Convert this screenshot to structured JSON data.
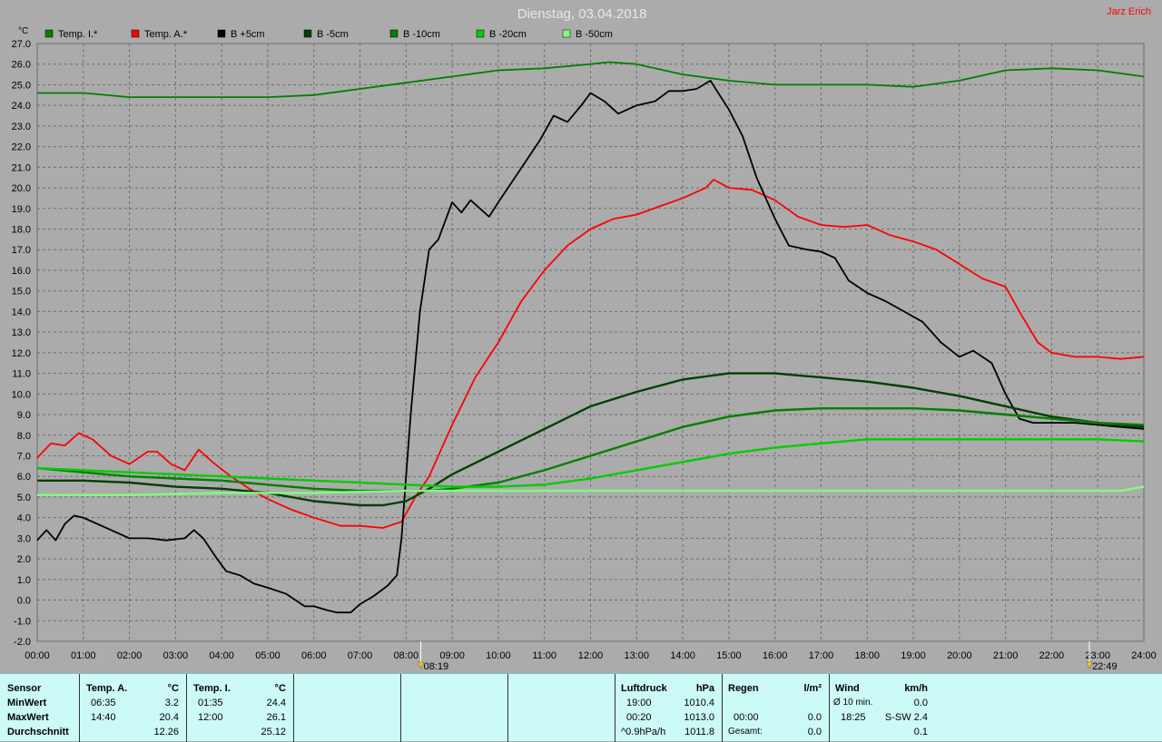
{
  "header": {
    "title": "Dienstag, 03.04.2018",
    "author": "Jarz Erich",
    "y_unit": "°C"
  },
  "chart_data": {
    "type": "line",
    "title": "Dienstag, 03.04.2018",
    "ylabel": "°C",
    "ylim": [
      -2.0,
      27.0
    ],
    "xlim": [
      0,
      24
    ],
    "grid": true,
    "legend": "top",
    "y_ticks": [
      "-2.0",
      "-1.0",
      "0.0",
      "1.0",
      "2.0",
      "3.0",
      "4.0",
      "5.0",
      "6.0",
      "7.0",
      "8.0",
      "9.0",
      "10.0",
      "11.0",
      "12.0",
      "13.0",
      "14.0",
      "15.0",
      "16.0",
      "17.0",
      "18.0",
      "19.0",
      "20.0",
      "21.0",
      "22.0",
      "23.0",
      "24.0",
      "25.0",
      "26.0",
      "27.0"
    ],
    "x_ticks": [
      "00:00",
      "01:00",
      "02:00",
      "03:00",
      "04:00",
      "05:00",
      "06:00",
      "07:00",
      "08:00",
      "09:00",
      "10:00",
      "11:00",
      "12:00",
      "13:00",
      "14:00",
      "15:00",
      "16:00",
      "17:00",
      "18:00",
      "19:00",
      "20:00",
      "21:00",
      "22:00",
      "23:00",
      "24:00"
    ],
    "markers": [
      {
        "label": "08:19",
        "x": 8.32
      },
      {
        "label": "22:49",
        "x": 22.82
      }
    ],
    "series": [
      {
        "name": "Temp. I.*",
        "color": "#007f00",
        "x": [
          0,
          1,
          2,
          3,
          4,
          5,
          6,
          7,
          8,
          9,
          10,
          11,
          12,
          12.4,
          13,
          14,
          15,
          16,
          17,
          18,
          19,
          20,
          21,
          22,
          23,
          24
        ],
        "y": [
          24.6,
          24.6,
          24.4,
          24.4,
          24.4,
          24.4,
          24.5,
          24.8,
          25.1,
          25.4,
          25.7,
          25.8,
          26.0,
          26.1,
          26.0,
          25.5,
          25.2,
          25.0,
          25.0,
          25.0,
          24.9,
          25.2,
          25.7,
          25.8,
          25.7,
          25.4
        ]
      },
      {
        "name": "Temp. A.*",
        "color": "#ff0000",
        "x": [
          0,
          0.3,
          0.6,
          0.9,
          1.2,
          1.6,
          2.0,
          2.4,
          2.6,
          2.9,
          3.2,
          3.5,
          3.8,
          4.2,
          4.6,
          5.0,
          5.5,
          6.0,
          6.58,
          7.0,
          7.5,
          7.9,
          8.2,
          8.5,
          9.0,
          9.5,
          10.0,
          10.5,
          11.0,
          11.5,
          12.0,
          12.5,
          13.0,
          13.5,
          14.0,
          14.5,
          14.67,
          15.0,
          15.5,
          16.0,
          16.5,
          17.0,
          17.5,
          18.0,
          18.5,
          19.0,
          19.5,
          20.0,
          20.5,
          21.0,
          21.3,
          21.7,
          22.0,
          22.5,
          23.0,
          23.5,
          24.0
        ],
        "y": [
          6.9,
          7.6,
          7.5,
          8.1,
          7.8,
          7.0,
          6.6,
          7.2,
          7.2,
          6.6,
          6.3,
          7.3,
          6.7,
          6.0,
          5.4,
          4.9,
          4.4,
          4.0,
          3.6,
          3.6,
          3.5,
          3.8,
          5.0,
          6.0,
          8.5,
          10.8,
          12.5,
          14.5,
          16.0,
          17.2,
          18.0,
          18.5,
          18.7,
          19.1,
          19.5,
          20.0,
          20.4,
          20.0,
          19.9,
          19.4,
          18.6,
          18.2,
          18.1,
          18.2,
          17.7,
          17.4,
          17.0,
          16.3,
          15.6,
          15.2,
          14.0,
          12.5,
          12.0,
          11.8,
          11.8,
          11.7,
          11.8
        ]
      },
      {
        "name": "B +5cm",
        "color": "#000000",
        "x": [
          0,
          0.2,
          0.4,
          0.6,
          0.8,
          1.0,
          1.3,
          1.6,
          2.0,
          2.4,
          2.8,
          3.2,
          3.4,
          3.6,
          3.9,
          4.1,
          4.4,
          4.7,
          5.0,
          5.4,
          5.8,
          6.0,
          6.3,
          6.5,
          6.8,
          7.0,
          7.3,
          7.6,
          7.8,
          7.9,
          8.0,
          8.1,
          8.2,
          8.3,
          8.5,
          8.7,
          9.0,
          9.2,
          9.4,
          9.6,
          9.8,
          10.0,
          10.3,
          10.6,
          10.9,
          11.2,
          11.5,
          11.8,
          12.0,
          12.3,
          12.6,
          13.0,
          13.4,
          13.7,
          14.0,
          14.3,
          14.6,
          14.8,
          15.0,
          15.3,
          15.6,
          16.0,
          16.3,
          16.7,
          17.0,
          17.3,
          17.6,
          18.0,
          18.4,
          18.8,
          19.2,
          19.6,
          20.0,
          20.3,
          20.7,
          21.0,
          21.3,
          21.6,
          22.0,
          22.5,
          23.0,
          23.5,
          24.0
        ],
        "y": [
          2.9,
          3.4,
          2.9,
          3.7,
          4.1,
          4.0,
          3.7,
          3.4,
          3.0,
          3.0,
          2.9,
          3.0,
          3.4,
          3.0,
          2.0,
          1.4,
          1.2,
          0.8,
          0.6,
          0.3,
          -0.3,
          -0.3,
          -0.5,
          -0.6,
          -0.6,
          -0.2,
          0.2,
          0.7,
          1.2,
          3.0,
          6.0,
          9.0,
          11.5,
          14.0,
          17.0,
          17.5,
          19.3,
          18.8,
          19.4,
          19.0,
          18.6,
          19.3,
          20.3,
          21.3,
          22.3,
          23.5,
          23.2,
          24.0,
          24.6,
          24.2,
          23.6,
          24.0,
          24.2,
          24.7,
          24.7,
          24.8,
          25.2,
          24.5,
          23.8,
          22.5,
          20.5,
          18.5,
          17.2,
          17.0,
          16.9,
          16.6,
          15.5,
          14.9,
          14.5,
          14.0,
          13.5,
          12.5,
          11.8,
          12.1,
          11.5,
          10.0,
          8.8,
          8.6,
          8.6,
          8.6,
          8.5,
          8.4,
          8.3
        ]
      },
      {
        "name": "B -5cm",
        "color": "#003f00",
        "x": [
          0,
          1,
          2,
          3,
          4,
          5,
          6,
          7,
          7.5,
          8.0,
          8.5,
          9.0,
          10.0,
          11.0,
          12.0,
          13.0,
          14.0,
          15.0,
          16.0,
          17.0,
          18.0,
          19.0,
          20.0,
          21.0,
          22.0,
          23.0,
          24.0
        ],
        "y": [
          5.8,
          5.8,
          5.7,
          5.5,
          5.4,
          5.2,
          4.8,
          4.6,
          4.6,
          4.8,
          5.4,
          6.1,
          7.2,
          8.3,
          9.4,
          10.1,
          10.7,
          11.0,
          11.0,
          10.8,
          10.6,
          10.3,
          9.9,
          9.4,
          8.9,
          8.6,
          8.4
        ]
      },
      {
        "name": "B -10cm",
        "color": "#007f00",
        "x": [
          0,
          1,
          2,
          3,
          4,
          5,
          6,
          7,
          8,
          8.5,
          9,
          10,
          11,
          12,
          13,
          14,
          15,
          16,
          17,
          18,
          19,
          20,
          21,
          22,
          23,
          24
        ],
        "y": [
          6.4,
          6.2,
          6.0,
          5.9,
          5.8,
          5.6,
          5.4,
          5.3,
          5.3,
          5.3,
          5.4,
          5.7,
          6.3,
          7.0,
          7.7,
          8.4,
          8.9,
          9.2,
          9.3,
          9.3,
          9.3,
          9.2,
          9.0,
          8.8,
          8.6,
          8.5
        ]
      },
      {
        "name": "B -20cm",
        "color": "#00cc00",
        "x": [
          0,
          1,
          2,
          3,
          4,
          5,
          6,
          7,
          8,
          9,
          10,
          11,
          12,
          13,
          14,
          15,
          16,
          17,
          18,
          19,
          20,
          21,
          22,
          23,
          24
        ],
        "y": [
          6.4,
          6.3,
          6.2,
          6.1,
          6.0,
          5.9,
          5.8,
          5.7,
          5.6,
          5.5,
          5.5,
          5.6,
          5.9,
          6.3,
          6.7,
          7.1,
          7.4,
          7.6,
          7.8,
          7.8,
          7.8,
          7.8,
          7.8,
          7.8,
          7.7
        ]
      },
      {
        "name": "B -50cm",
        "color": "#80ff80",
        "x": [
          0,
          2,
          4,
          6,
          8,
          10,
          12,
          14,
          16,
          18,
          20,
          22,
          23.5,
          24
        ],
        "y": [
          5.1,
          5.1,
          5.2,
          5.2,
          5.3,
          5.3,
          5.3,
          5.3,
          5.3,
          5.3,
          5.3,
          5.3,
          5.3,
          5.5
        ]
      }
    ]
  },
  "table": {
    "sensor": {
      "header": "Sensor",
      "rows": [
        "MinWert",
        "MaxWert",
        "Durchschnitt"
      ]
    },
    "temp_a": {
      "header": "Temp. A.",
      "unit": "°C",
      "min_time": "06:35",
      "min_val": "3.2",
      "max_time": "14:40",
      "max_val": "20.4",
      "avg": "12.26"
    },
    "temp_i": {
      "header": "Temp. I.",
      "unit": "°C",
      "min_time": "01:35",
      "min_val": "24.4",
      "max_time": "12:00",
      "max_val": "26.1",
      "avg": "25.12"
    },
    "luftdruck": {
      "header": "Luftdruck",
      "unit": "hPa",
      "min_time": "19:00",
      "min_val": "1010.4",
      "max_time": "00:20",
      "max_val": "1013.0",
      "trend_label": "^0.9hPa/h",
      "avg": "1011.8"
    },
    "regen": {
      "header": "Regen",
      "unit": "l/m²",
      "max_time": "00:00",
      "max_val": "0.0",
      "total_label": "Gesamt:",
      "total": "0.0"
    },
    "wind": {
      "header": "Wind",
      "unit": "km/h",
      "row1_label": "Ø 10 min.",
      "row1_val": "0.0",
      "row2_time": "18:25",
      "row2_val": "S-SW 2.4",
      "avg": "0.1"
    }
  }
}
